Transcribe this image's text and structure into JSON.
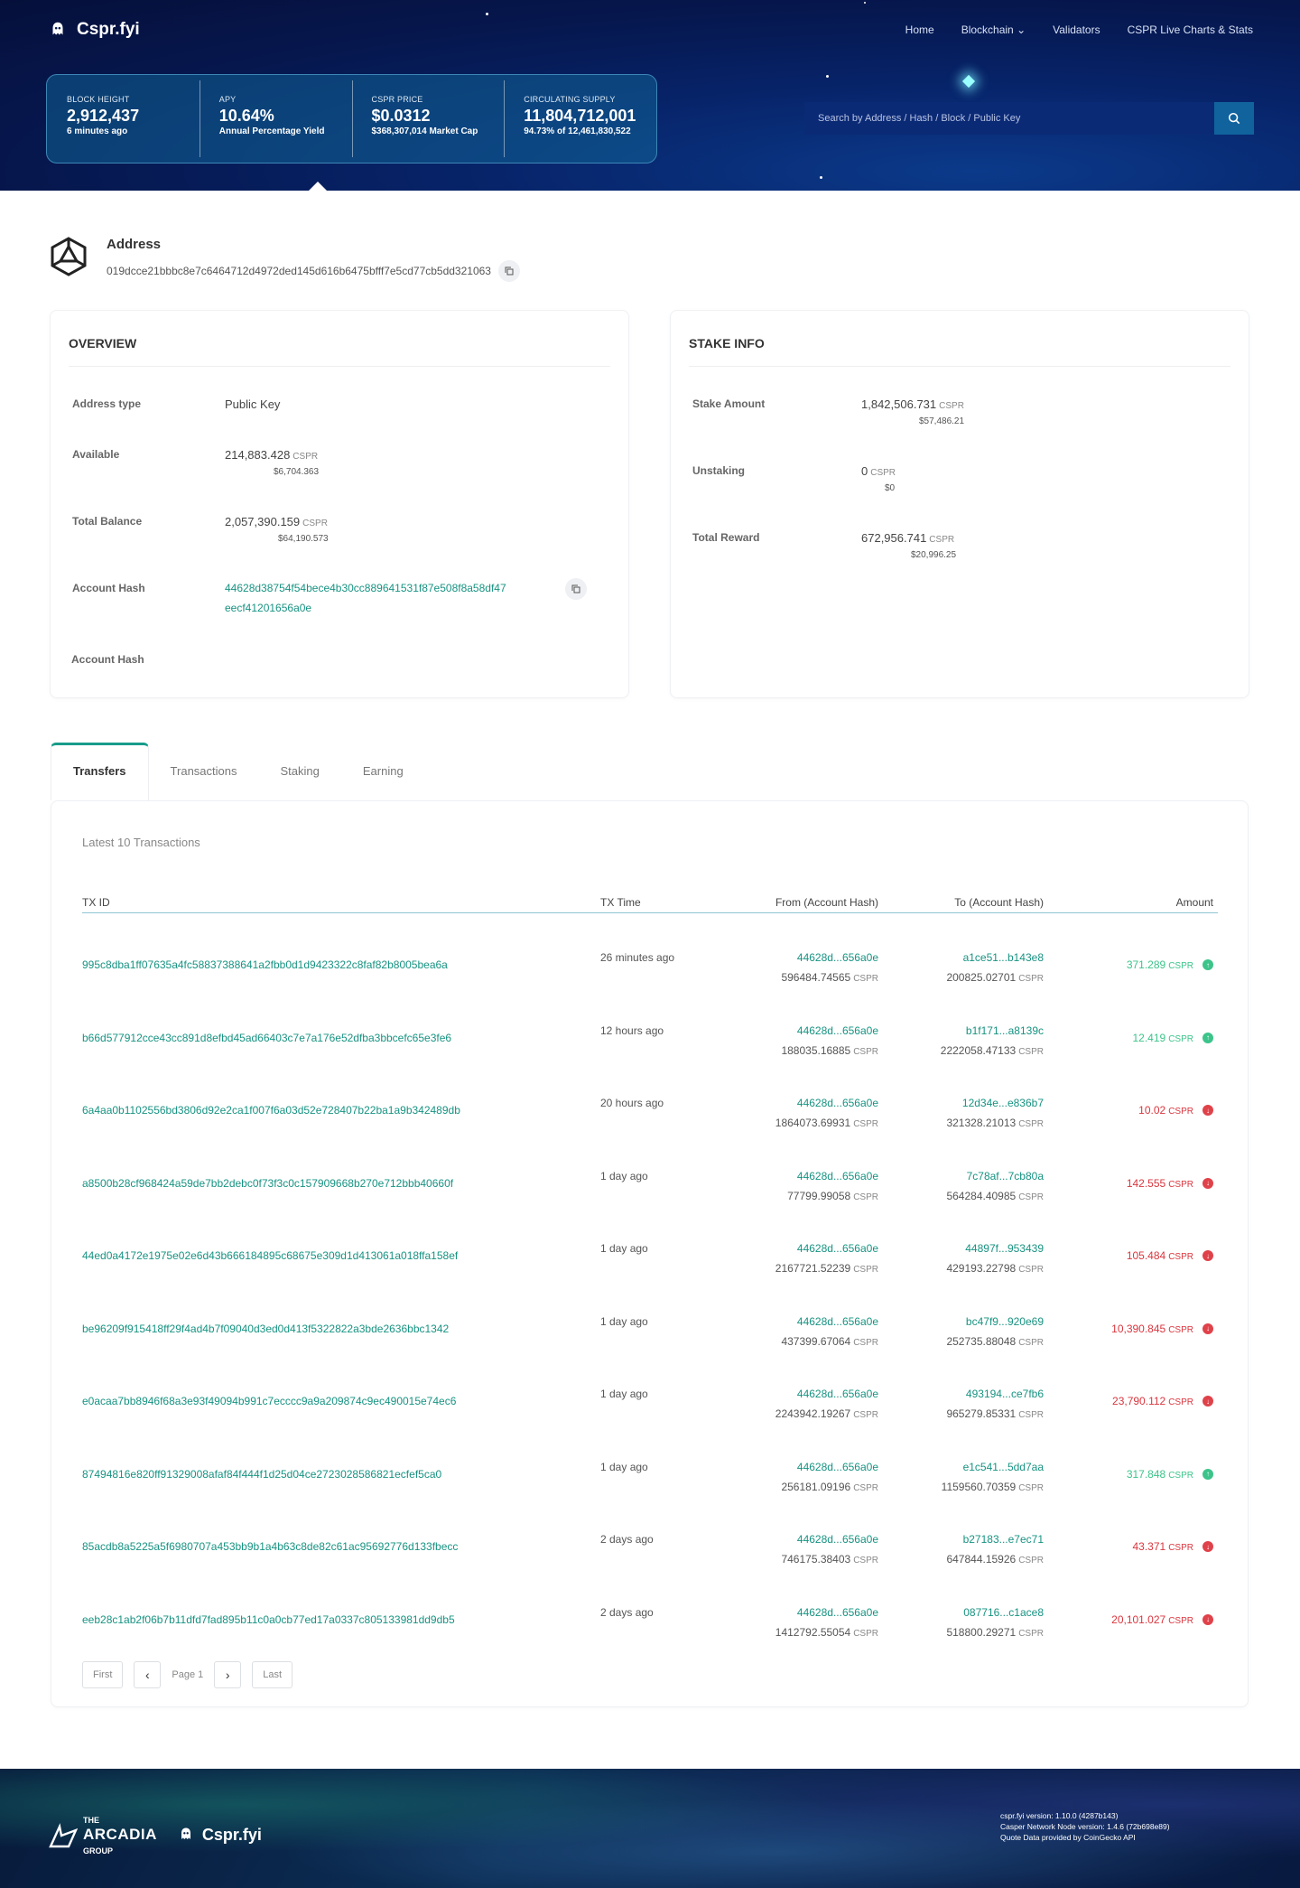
{
  "brand": {
    "name": "Cspr.fyi"
  },
  "nav": {
    "home": "Home",
    "blockchain": "Blockchain",
    "validators": "Validators",
    "charts": "CSPR Live Charts & Stats"
  },
  "stats": [
    {
      "label": "BLOCK HEIGHT",
      "value": "2,912,437",
      "sub": "6 minutes ago"
    },
    {
      "label": "APY",
      "value": "10.64%",
      "sub": "Annual Percentage Yield"
    },
    {
      "label": "CSPR PRICE",
      "value": "$0.0312",
      "sub": "$368,307,014 Market Cap"
    },
    {
      "label": "CIRCULATING SUPPLY",
      "value": "11,804,712,001",
      "sub": "94.73% of 12,461,830,522"
    }
  ],
  "search": {
    "placeholder": "Search by Address / Hash / Block / Public Key"
  },
  "address": {
    "title": "Address",
    "key": "019dcce21bbbc8e7c6464712d4972ded145d616b6475bfff7e5cd77cb5dd321063"
  },
  "overview": {
    "title": "OVERVIEW",
    "type_label": "Address type",
    "type_value": "Public Key",
    "available_label": "Available",
    "available_value": "214,883.428",
    "available_unit": "CSPR",
    "available_usd": "$6,704.363",
    "total_label": "Total Balance",
    "total_value": "2,057,390.159",
    "total_unit": "CSPR",
    "total_usd": "$64,190.573",
    "hash_label": "Account Hash",
    "hash_line1": "44628d38754f54bece4b30cc889641531f87e508f8a58df47",
    "hash_line2": "eecf41201656a0e",
    "hash2_label": "Account Hash"
  },
  "stake": {
    "title": "STAKE INFO",
    "amount_label": "Stake Amount",
    "amount_value": "1,842,506.731",
    "amount_unit": "CSPR",
    "amount_usd": "$57,486.21",
    "unstaking_label": "Unstaking",
    "unstaking_value": "0",
    "unstaking_unit": "CSPR",
    "unstaking_usd": "$0",
    "reward_label": "Total Reward",
    "reward_value": "672,956.741",
    "reward_unit": "CSPR",
    "reward_usd": "$20,996.25"
  },
  "tabs": [
    "Transfers",
    "Transactions",
    "Staking",
    "Earning"
  ],
  "table": {
    "caption": "Latest 10 Transactions",
    "headers": {
      "id": "TX ID",
      "time": "TX Time",
      "from": "From (Account Hash)",
      "to": "To (Account Hash)",
      "amount": "Amount"
    },
    "unit": "CSPR",
    "rows": [
      {
        "id": "995c8dba1ff07635a4fc58837388641a2fbb0d1d9423322c8faf82b8005bea6a",
        "time": "26 minutes ago",
        "from": "44628d...656a0e",
        "from_bal": "596484.74565",
        "to": "a1ce51...b143e8",
        "to_bal": "200825.02701",
        "amount": "371.289",
        "dir": "in"
      },
      {
        "id": "b66d577912cce43cc891d8efbd45ad66403c7e7a176e52dfba3bbcefc65e3fe6",
        "time": "12 hours ago",
        "from": "44628d...656a0e",
        "from_bal": "188035.16885",
        "to": "b1f171...a8139c",
        "to_bal": "2222058.47133",
        "amount": "12.419",
        "dir": "in"
      },
      {
        "id": "6a4aa0b1102556bd3806d92e2ca1f007f6a03d52e728407b22ba1a9b342489db",
        "time": "20 hours ago",
        "from": "44628d...656a0e",
        "from_bal": "1864073.69931",
        "to": "12d34e...e836b7",
        "to_bal": "321328.21013",
        "amount": "10.02",
        "dir": "out"
      },
      {
        "id": "a8500b28cf968424a59de7bb2debc0f73f3c0c157909668b270e712bbb40660f",
        "time": "1 day ago",
        "from": "44628d...656a0e",
        "from_bal": "77799.99058",
        "to": "7c78af...7cb80a",
        "to_bal": "564284.40985",
        "amount": "142.555",
        "dir": "out"
      },
      {
        "id": "44ed0a4172e1975e02e6d43b666184895c68675e309d1d413061a018ffa158ef",
        "time": "1 day ago",
        "from": "44628d...656a0e",
        "from_bal": "2167721.52239",
        "to": "44897f...953439",
        "to_bal": "429193.22798",
        "amount": "105.484",
        "dir": "out"
      },
      {
        "id": "be96209f915418ff29f4ad4b7f09040d3ed0d413f5322822a3bde2636bbc1342",
        "time": "1 day ago",
        "from": "44628d...656a0e",
        "from_bal": "437399.67064",
        "to": "bc47f9...920e69",
        "to_bal": "252735.88048",
        "amount": "10,390.845",
        "dir": "out"
      },
      {
        "id": "e0acaa7bb8946f68a3e93f49094b991c7ecccc9a9a209874c9ec490015e74ec6",
        "time": "1 day ago",
        "from": "44628d...656a0e",
        "from_bal": "2243942.19267",
        "to": "493194...ce7fb6",
        "to_bal": "965279.85331",
        "amount": "23,790.112",
        "dir": "out"
      },
      {
        "id": "87494816e820ff91329008afaf84f444f1d25d04ce2723028586821ecfef5ca0",
        "time": "1 day ago",
        "from": "44628d...656a0e",
        "from_bal": "256181.09196",
        "to": "e1c541...5dd7aa",
        "to_bal": "1159560.70359",
        "amount": "317.848",
        "dir": "in"
      },
      {
        "id": "85acdb8a5225a5f6980707a453bb9b1a4b63c8de82c61ac95692776d133fbecc",
        "time": "2 days ago",
        "from": "44628d...656a0e",
        "from_bal": "746175.38403",
        "to": "b27183...e7ec71",
        "to_bal": "647844.15926",
        "amount": "43.371",
        "dir": "out"
      },
      {
        "id": "eeb28c1ab2f06b7b11dfd7fad895b11c0a0cb77ed17a0337c805133981dd9db5",
        "time": "2 days ago",
        "from": "44628d...656a0e",
        "from_bal": "1412792.55054",
        "to": "087716...c1ace8",
        "to_bal": "518800.29271",
        "amount": "20,101.027",
        "dir": "out"
      }
    ]
  },
  "pager": {
    "first": "First",
    "page": "Page 1",
    "last": "Last"
  },
  "footer": {
    "arcadia_the": "THE",
    "arcadia_name": "ARCADIA",
    "arcadia_group": "GROUP",
    "brand": "Cspr.fyi",
    "version": "cspr.fyi version: 1.10.0 (4287b143)",
    "node": "Casper Network Node version: 1.4.6 (72b698e89)",
    "quote": "Quote Data provided by CoinGecko API"
  },
  "colors": {
    "accent": "#179382",
    "positive": "#3cc48a",
    "negative": "#d9363e"
  }
}
